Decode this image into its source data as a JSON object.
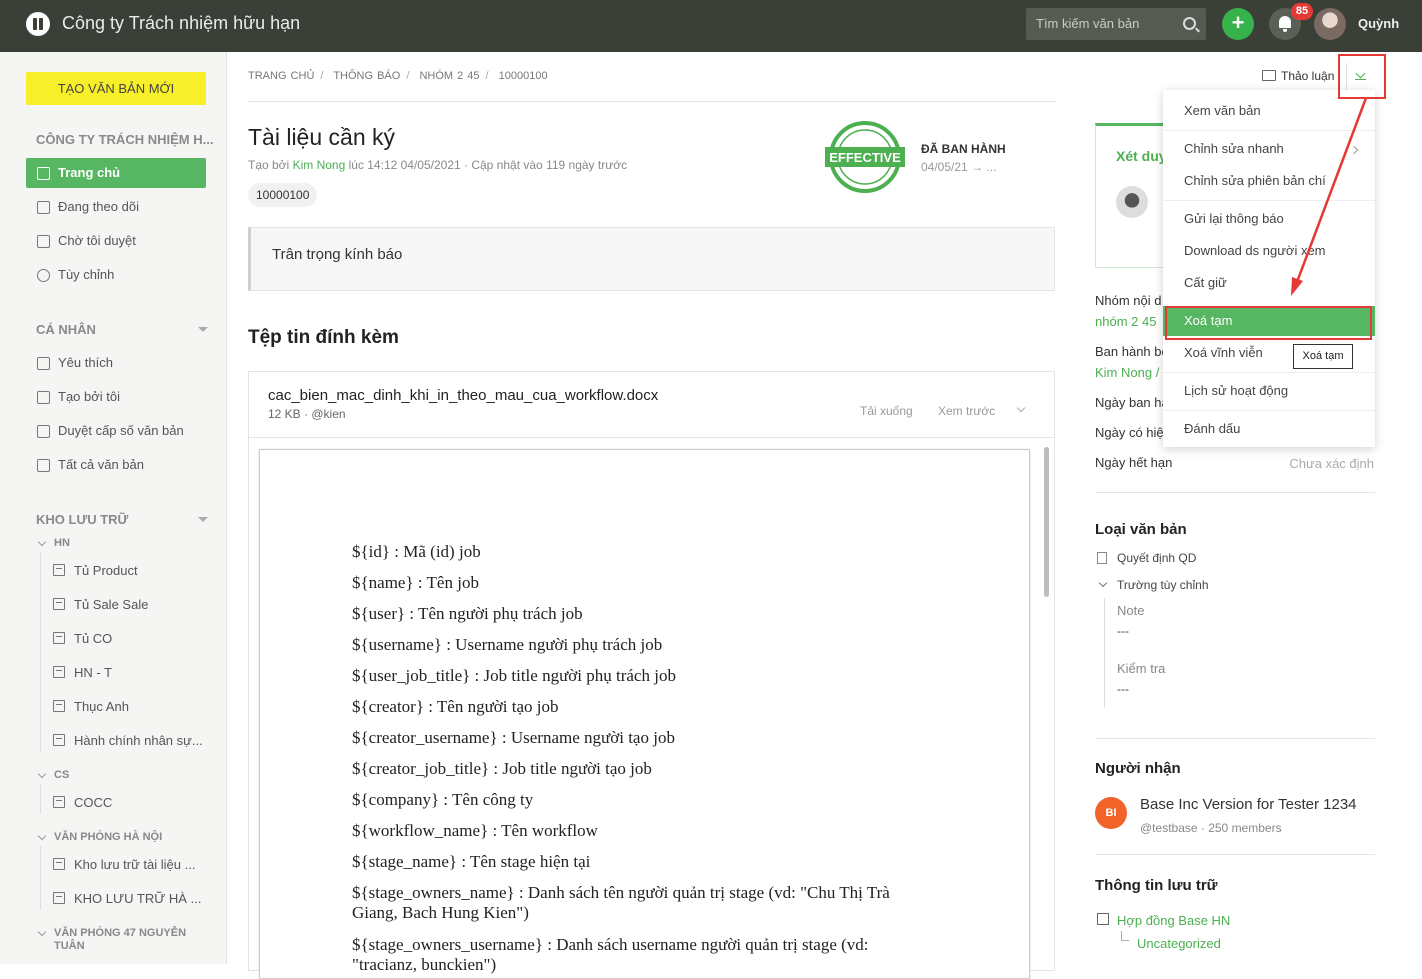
{
  "header": {
    "company": "Công ty Trách nhiệm hữu hạn",
    "search_placeholder": "Tìm kiếm văn bản",
    "notif_count": "85",
    "user": "Quỳnh"
  },
  "sidebar": {
    "new_button": "TẠO VĂN BẢN MỚI",
    "org": "CÔNG TY TRÁCH NHIỆM H...",
    "main_items": [
      "Trang chủ",
      "Đang theo dõi",
      "Chờ tôi duyệt",
      "Tùy chỉnh"
    ],
    "personal_title": "CÁ NHÂN",
    "personal_items": [
      "Yêu thích",
      "Tạo bởi tôi",
      "Duyệt cấp số văn bản",
      "Tất cả văn bản"
    ],
    "storage_title": "KHO LƯU TRỮ",
    "groups": [
      {
        "name": "HN",
        "items": [
          "Tủ Product",
          "Tủ Sale Sale",
          "Tủ CO",
          "HN - T",
          "Thục Anh",
          "Hành chính nhân sự..."
        ]
      },
      {
        "name": "CS",
        "items": [
          "COCC"
        ]
      },
      {
        "name": "VĂN PHÒNG HÀ NỘI",
        "items": [
          "Kho lưu trữ tài liệu ...",
          "KHO LƯU TRỮ HÀ ..."
        ]
      },
      {
        "name": "VĂN PHÒNG 47 NGUYỄN TUÂN",
        "items": []
      }
    ]
  },
  "breadcrumb": [
    "TRANG CHỦ",
    "THÔNG BÁO",
    "NHÓM 2 45",
    "10000100"
  ],
  "doc": {
    "title": "Tài liệu cần ký",
    "meta_prefix": "Tạo bởi ",
    "author": "Kim Nong",
    "meta_suffix": " lúc 14:12 04/05/2021 · Cập nhật vào 119 ngày trước",
    "tag": "10000100",
    "stamp_text": "EFFECTIVE",
    "status": "ĐÃ BAN HÀNH",
    "status_date": "04/05/21 → ...",
    "message": "Trân trọng kính báo",
    "attach_heading": "Tệp tin đính kèm",
    "file": {
      "name": "cac_bien_mac_dinh_khi_in_theo_mau_cua_workflow.docx",
      "sub": "12 KB · @kien",
      "download": "Tải xuống",
      "preview": "Xem trước"
    },
    "preview_lines": [
      "${id} : Mã (id) job",
      "${name} : Tên job",
      "${user} : Tên người phụ trách job",
      "${username} : Username người phụ trách job",
      "${user_job_title} : Job title người phụ trách job",
      "${creator} : Tên người tạo job",
      "${creator_username} : Username người tạo job",
      "${creator_job_title} :  Job title người tạo job",
      "${company} : Tên công ty",
      "${workflow_name} : Tên workflow",
      "${stage_name} : Tên stage hiện tại",
      "${stage_owners_name} : Danh sách tên người quản trị stage (vd: \"Chu Thị Trà Giang, Bach Hung Kien\")",
      "${stage_owners_username} : Danh sách username người quản trị stage (vd: \"tracianz, bunckien\")"
    ]
  },
  "right": {
    "discuss": "Thảo luận",
    "review_title": "Xét duy",
    "group_label": "Nhóm nội d",
    "group_value": "nhóm 2 45",
    "issuer_label": "Ban hành bở",
    "issuer_value": "Kim Nong /",
    "issue_date_label": "Ngày ban hà",
    "effective_label": "Ngày có hiệ",
    "expire_label": "Ngày hết hạn",
    "expire_value": "Chưa xác định",
    "type_heading": "Loại văn bản",
    "type_value": "Quyết định QD",
    "custom_fields": "Trường tùy chỉnh",
    "note_label": "Note",
    "note_value": "---",
    "check_label": "Kiểm tra",
    "check_value": "---",
    "recipients_heading": "Người nhận",
    "recipient_initials": "BI",
    "recipient_name": "Base Inc Version for Tester 1234",
    "recipient_sub": "@testbase · 250 members",
    "storage_heading": "Thông tin lưu trữ",
    "storage_value": "Hợp đồng Base HN",
    "storage_sub": "Uncategorized"
  },
  "menu": {
    "items": [
      "Xem văn bản",
      "Chỉnh sửa nhanh",
      "Chỉnh sửa phiên bản chí",
      "Gửi lại thông báo",
      "Download ds người xem",
      "Cất giữ",
      "Xoá tạm",
      "Xoá vĩnh viễn",
      "Lịch sử hoạt động",
      "Đánh dấu"
    ],
    "tooltip": "Xoá tạm"
  },
  "colors": {
    "accent": "#56b662",
    "topbar": "#3a3f38",
    "annotation": "#e53935",
    "new_button": "#f7ef2a"
  }
}
